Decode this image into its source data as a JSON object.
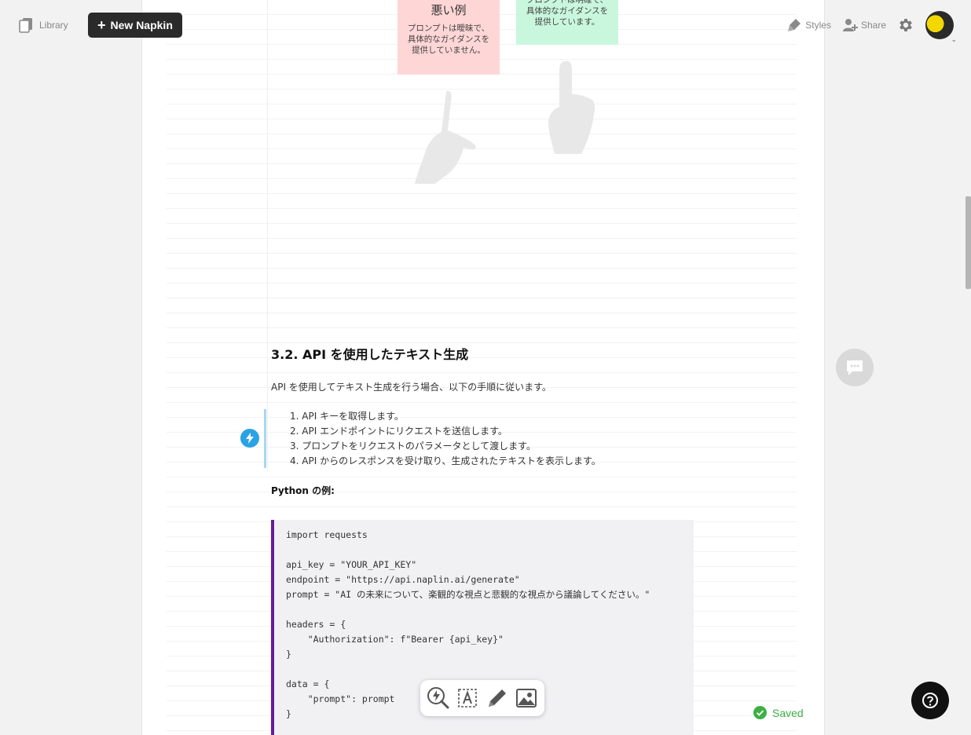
{
  "topbar": {
    "library_label": "Library",
    "new_napkin_label": "New Napkin",
    "styles_label": "Styles",
    "share_label": "Share"
  },
  "illustration": {
    "bad_title": "悪い例",
    "bad_desc": "プロンプトは曖昧で、具体的なガイダンスを提供していません。",
    "good_desc": "プロンプトは明確で、具体的なガイダンスを提供しています。"
  },
  "content": {
    "heading": "3.2. API を使用したテキスト生成",
    "intro": "API を使用してテキスト生成を行う場合、以下の手順に従います。",
    "steps": [
      "1. API キーを取得します。",
      "2. API エンドポイントにリクエストを送信します。",
      "3. プロンプトをリクエストのパラメータとして渡します。",
      "4. API からのレスポンスを受け取り、生成されたテキストを表示します。"
    ],
    "python_heading": "Python の例:",
    "code_lines": [
      "import requests",
      "",
      "api_key = \"YOUR_API_KEY\"",
      "endpoint = \"https://api.naplin.ai/generate\"",
      "prompt = \"AI の未来について、楽観的な視点と悲観的な視点から議論してください。\"",
      "",
      "headers = {",
      "    \"Authorization\": f\"Bearer {api_key}\"",
      "}",
      "",
      "data = {",
      "    \"prompt\": prompt",
      "}"
    ]
  },
  "status": {
    "saved_label": "Saved"
  },
  "icons": {
    "library": "library-icon",
    "styles": "styles-icon",
    "share": "share-icon",
    "settings": "gear-icon",
    "help": "help-icon",
    "comment": "comment-icon",
    "spark": "spark-icon"
  },
  "colors": {
    "accent_code_border": "#6a1b9a",
    "saved_green": "#3cb043",
    "spark_blue": "#2aa3e6",
    "bad_card": "#ffd6d6",
    "good_card": "#c9f7dd"
  }
}
